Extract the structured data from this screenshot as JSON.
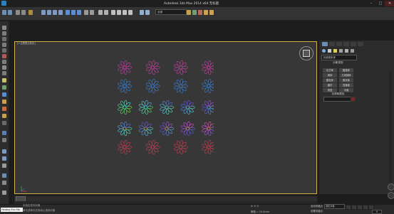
{
  "window": {
    "title": "Autodesk 3ds Max  2014 x64      无标题",
    "min": "–",
    "max": "□",
    "close": "✕"
  },
  "toolbar": {
    "selection_filter": "全部"
  },
  "viewport": {
    "label": "[+][透视][真实]"
  },
  "command_panel": {
    "creation_type": "标准基本体",
    "object_type_title": "对象类型",
    "object_buttons": [
      "长方体",
      "圆锥体",
      "球体",
      "几何球体",
      "圆柱体",
      "管状体",
      "圆环",
      "四棱锥",
      "茶壶",
      "平面"
    ],
    "name_color_title": "名称和颜色"
  },
  "status": {
    "line1": "未选定任何对象",
    "line2": "单击或单击并拖动以选择对象",
    "maxscript": "Fantasy Env Ma",
    "coords": "X:    Y:    Z:",
    "grid": "栅格 = 10.0mm",
    "auto_key": "自动关键点",
    "set_key": "设置关键点",
    "selection_set": "选定对象",
    "frame": "0"
  },
  "colors": {
    "accent": "#d2b04b",
    "bg": "#1d1d1d",
    "swatch": "#8a1d26"
  },
  "icons": [
    "app-logo-icon",
    "undo-icon",
    "redo-icon",
    "link-icon",
    "unlink-icon",
    "select-icon",
    "move-icon",
    "rotate-icon",
    "scale-icon",
    "snap-icon",
    "render-icon",
    "view-cube-icon",
    "axis-tripod-icon",
    "play-icon"
  ]
}
